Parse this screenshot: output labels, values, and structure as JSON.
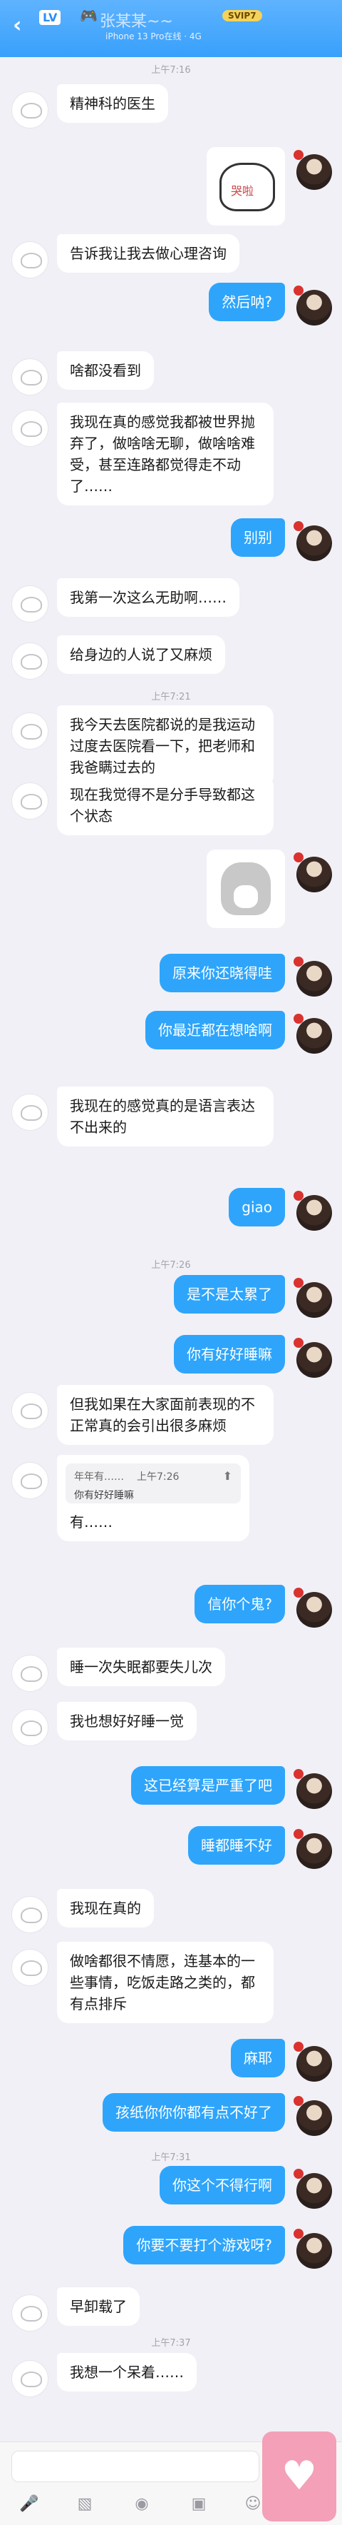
{
  "header": {
    "back": "‹",
    "level_badge": "LV",
    "game_icon": "🎮",
    "contact_name": "张某某~~",
    "vip_badge": "SVIP7",
    "subtitle": "iPhone 13 Pro在线 · 4G"
  },
  "chat": [
    {
      "type": "time",
      "text": "上午7:16"
    },
    {
      "type": "msg",
      "side": "left",
      "text": "精神科的医生"
    },
    {
      "type": "sticker",
      "side": "right",
      "sticker": "crying-cat-sticker"
    },
    {
      "type": "msg",
      "side": "left",
      "text": "告诉我让我去做心理咨询"
    },
    {
      "type": "msg",
      "side": "right",
      "text": "然后呐?"
    },
    {
      "type": "msg",
      "side": "left",
      "text": "啥都没看到"
    },
    {
      "type": "msg",
      "side": "left",
      "text": "我现在真的感觉我都被世界抛弃了，做啥啥无聊，做啥啥难受，甚至连路都觉得走不动了……"
    },
    {
      "type": "msg",
      "side": "right",
      "text": "别别"
    },
    {
      "type": "msg",
      "side": "left",
      "text": "我第一次这么无助啊……"
    },
    {
      "type": "msg",
      "side": "left",
      "text": "给身边的人说了又麻烦"
    },
    {
      "type": "time",
      "text": "上午7:21"
    },
    {
      "type": "msg",
      "side": "left",
      "text": "我今天去医院都说的是我运动过度去医院看一下，把老师和我爸瞒过去的"
    },
    {
      "type": "msg",
      "side": "left",
      "text": "现在我觉得不是分手导致都这个状态"
    },
    {
      "type": "sticker",
      "side": "right",
      "sticker": "husky-dog-sticker"
    },
    {
      "type": "msg",
      "side": "right",
      "text": "原来你还晓得哇"
    },
    {
      "type": "msg",
      "side": "right",
      "text": "你最近都在想啥啊"
    },
    {
      "type": "msg",
      "side": "left",
      "text": "我现在的感觉真的是语言表达不出来的"
    },
    {
      "type": "msg",
      "side": "right",
      "text": "giao"
    },
    {
      "type": "time",
      "text": "上午7:26"
    },
    {
      "type": "msg",
      "side": "right",
      "text": "是不是太累了"
    },
    {
      "type": "msg",
      "side": "right",
      "text": "你有好好睡嘛"
    },
    {
      "type": "msg",
      "side": "left",
      "text": "但我如果在大家面前表现的不正常真的会引出很多麻烦"
    },
    {
      "type": "quote",
      "side": "left",
      "quote_name": "年年有……",
      "quote_time": "上午7:26",
      "quote_text": "你有好好睡嘛",
      "text": "有……"
    },
    {
      "type": "msg",
      "side": "right",
      "text": "信你个鬼?"
    },
    {
      "type": "msg",
      "side": "left",
      "text": "睡一次失眠都要失儿次"
    },
    {
      "type": "msg",
      "side": "left",
      "text": "我也想好好睡一觉"
    },
    {
      "type": "msg",
      "side": "right",
      "text": "这已经算是严重了吧"
    },
    {
      "type": "msg",
      "side": "right",
      "text": "睡都睡不好"
    },
    {
      "type": "msg",
      "side": "left",
      "text": "我现在真的"
    },
    {
      "type": "msg",
      "side": "left",
      "text": "做啥都很不情愿，连基本的一些事情，吃饭走路之类的，都有点排斥"
    },
    {
      "type": "msg",
      "side": "right",
      "text": "麻耶"
    },
    {
      "type": "msg",
      "side": "right",
      "text": "孩纸你你你都有点不好了"
    },
    {
      "type": "time",
      "text": "上午7:31"
    },
    {
      "type": "msg",
      "side": "right",
      "text": "你这个不得行啊"
    },
    {
      "type": "msg",
      "side": "right",
      "text": "你要不要打个游戏呀?"
    },
    {
      "type": "msg",
      "side": "left",
      "text": "早卸载了"
    },
    {
      "type": "time",
      "text": "上午7:37"
    },
    {
      "type": "msg",
      "side": "left",
      "text": "我想一个呆着……"
    }
  ],
  "input": {
    "placeholder": ""
  },
  "toolbar": [
    {
      "name": "voice-icon",
      "glyph": "🎤"
    },
    {
      "name": "image-icon",
      "glyph": "▧"
    },
    {
      "name": "camera-icon",
      "glyph": "◉"
    },
    {
      "name": "red-packet-icon",
      "glyph": "▣"
    },
    {
      "name": "emoji-icon",
      "glyph": "☺"
    }
  ],
  "watermark_glyph": "♥"
}
